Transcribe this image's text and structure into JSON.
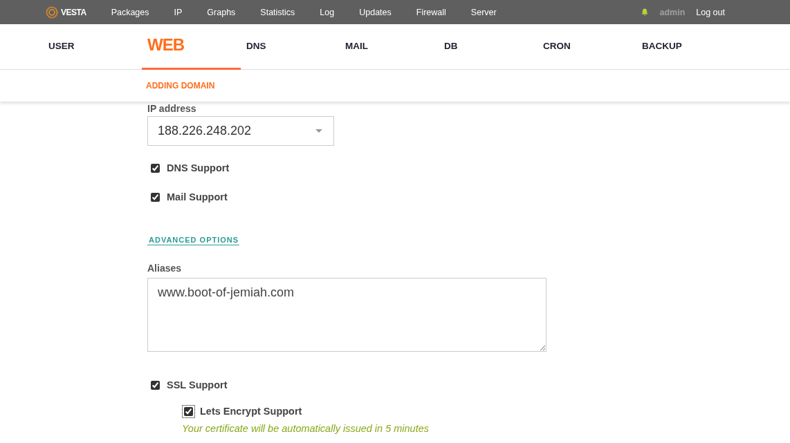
{
  "top_menu": {
    "logo": "VESTA",
    "items": [
      "Packages",
      "IP",
      "Graphs",
      "Statistics",
      "Log",
      "Updates",
      "Firewall",
      "Server"
    ],
    "user": "admin",
    "logout": "Log out"
  },
  "tabs": [
    {
      "label": "USER",
      "selected": false
    },
    {
      "label": "WEB",
      "selected": true
    },
    {
      "label": "DNS",
      "selected": false
    },
    {
      "label": "MAIL",
      "selected": false
    },
    {
      "label": "DB",
      "selected": false
    },
    {
      "label": "CRON",
      "selected": false
    },
    {
      "label": "BACKUP",
      "selected": false
    }
  ],
  "subtitle": "ADDING DOMAIN",
  "form": {
    "ip_label": "IP address",
    "ip_value": "188.226.248.202",
    "options": [
      {
        "label": "DNS Support",
        "checked": true
      },
      {
        "label": "Mail Support",
        "checked": true
      }
    ],
    "advanced_link": "ADVANCED OPTIONS",
    "aliases_label": "Aliases",
    "aliases_value": "www.boot-of-jemiah.com",
    "ssl": {
      "label": "SSL Support",
      "checked": true
    },
    "letsencrypt": {
      "label": "Lets Encrypt Support",
      "checked": true,
      "focused": true
    },
    "note": "Your certificate will be automatically issued in 5 minutes"
  }
}
